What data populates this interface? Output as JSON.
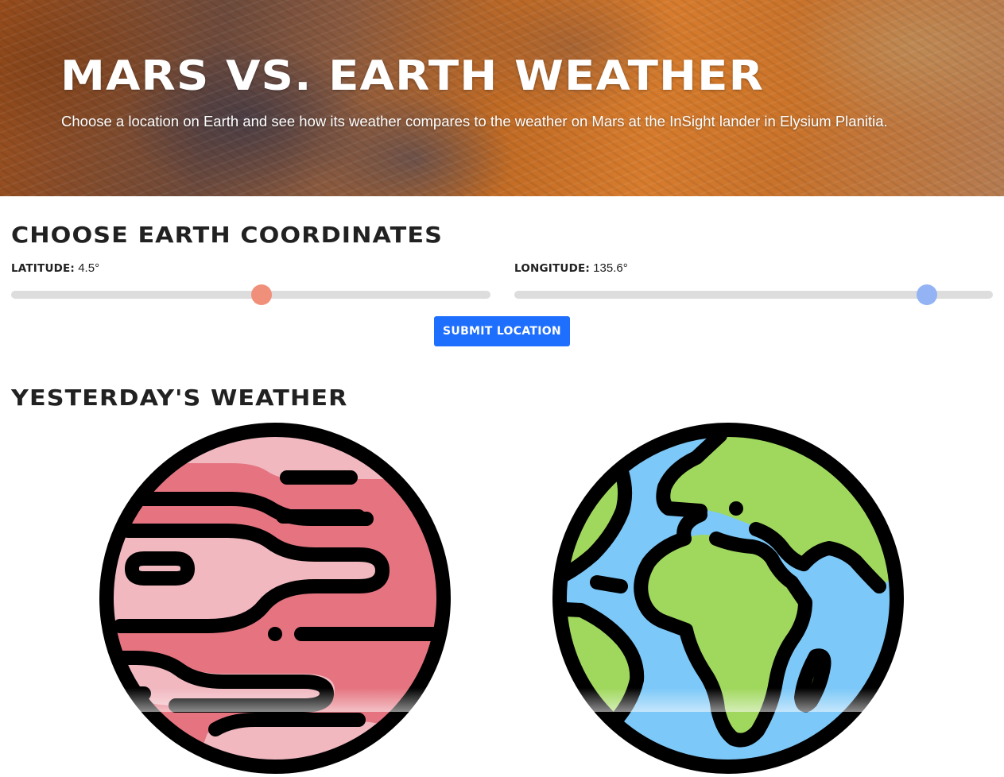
{
  "hero": {
    "title": "Mars vs. Earth Weather",
    "subtitle": "Choose a location on Earth and see how its weather compares to the weather on Mars at the InSight lander in Elysium Planitia."
  },
  "coordinates": {
    "heading": "Choose Earth Coordinates",
    "latitude": {
      "label": "Latitude:",
      "value": "4.5°",
      "fraction": 0.523,
      "thumb_color": "#f0907a"
    },
    "longitude": {
      "label": "Longitude:",
      "value": "135.6°",
      "fraction": 0.862,
      "thumb_color": "#93b3f5"
    },
    "submit_label": "Submit Location"
  },
  "weather": {
    "heading": "Yesterday's Weather",
    "mars_icon": "mars-planet-icon",
    "earth_icon": "earth-globe-icon"
  },
  "colors": {
    "accent": "#1f6fff",
    "mars_dark": "#e57480",
    "mars_light": "#f1b8c0",
    "earth_ocean": "#7cc8f8",
    "earth_land": "#a0d85e"
  }
}
